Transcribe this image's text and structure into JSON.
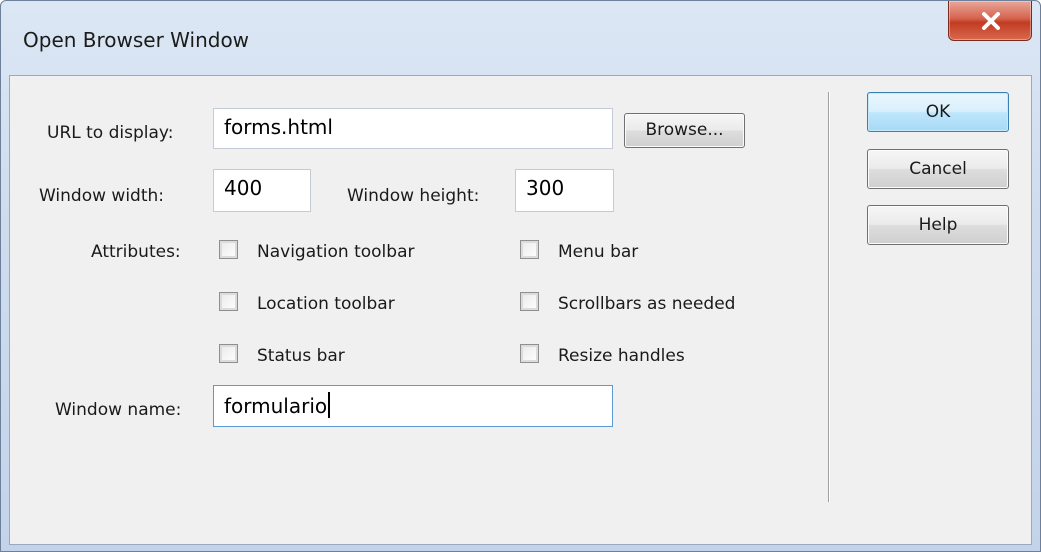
{
  "window": {
    "title": "Open Browser Window"
  },
  "fields": {
    "url_label": "URL to display:",
    "url_value": "forms.html",
    "browse_label": "Browse...",
    "width_label": "Window width:",
    "width_value": "400",
    "height_label": "Window height:",
    "height_value": "300",
    "attributes_label": "Attributes:",
    "name_label": "Window name:",
    "name_value": "formulario"
  },
  "attributes": {
    "navigation_toolbar": {
      "label": "Navigation toolbar",
      "checked": false
    },
    "menu_bar": {
      "label": "Menu bar",
      "checked": false
    },
    "location_toolbar": {
      "label": "Location toolbar",
      "checked": false
    },
    "scrollbars": {
      "label": "Scrollbars as needed",
      "checked": false
    },
    "status_bar": {
      "label": "Status bar",
      "checked": false
    },
    "resize_handles": {
      "label": "Resize handles",
      "checked": false
    }
  },
  "buttons": {
    "ok": "OK",
    "cancel": "Cancel",
    "help": "Help"
  },
  "icons": {
    "close": "close-icon"
  },
  "colors": {
    "title_bar": "#cfdcee",
    "close_button": "#c13c22",
    "dialog_bg": "#f0f0f0",
    "default_button": "#bee6fd",
    "focus_border": "#5b9bd5"
  }
}
